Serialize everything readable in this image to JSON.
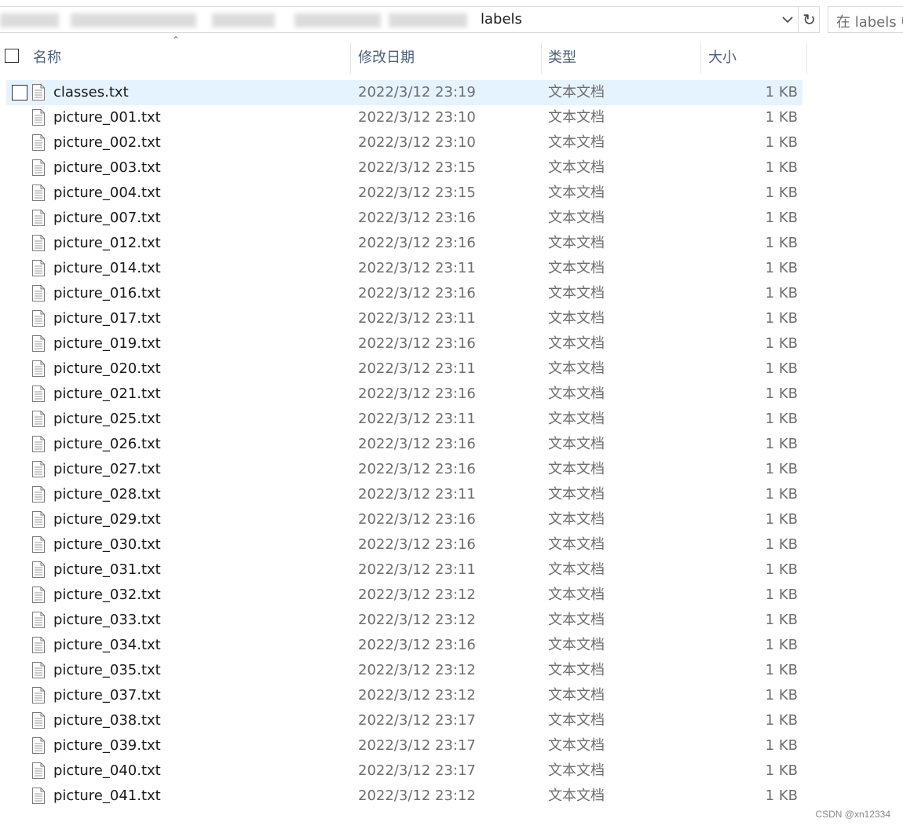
{
  "address_bar": {
    "current_folder": "labels",
    "search_placeholder": "在 labels 中搜索"
  },
  "columns": {
    "name": "名称",
    "date_modified": "修改日期",
    "type": "类型",
    "size": "大小"
  },
  "files": [
    {
      "name": "classes.txt",
      "date": "2022/3/12 23:19",
      "type": "文本文档",
      "size": "1 KB",
      "selected": true
    },
    {
      "name": "picture_001.txt",
      "date": "2022/3/12 23:10",
      "type": "文本文档",
      "size": "1 KB"
    },
    {
      "name": "picture_002.txt",
      "date": "2022/3/12 23:10",
      "type": "文本文档",
      "size": "1 KB"
    },
    {
      "name": "picture_003.txt",
      "date": "2022/3/12 23:15",
      "type": "文本文档",
      "size": "1 KB"
    },
    {
      "name": "picture_004.txt",
      "date": "2022/3/12 23:15",
      "type": "文本文档",
      "size": "1 KB"
    },
    {
      "name": "picture_007.txt",
      "date": "2022/3/12 23:16",
      "type": "文本文档",
      "size": "1 KB"
    },
    {
      "name": "picture_012.txt",
      "date": "2022/3/12 23:16",
      "type": "文本文档",
      "size": "1 KB"
    },
    {
      "name": "picture_014.txt",
      "date": "2022/3/12 23:11",
      "type": "文本文档",
      "size": "1 KB"
    },
    {
      "name": "picture_016.txt",
      "date": "2022/3/12 23:16",
      "type": "文本文档",
      "size": "1 KB"
    },
    {
      "name": "picture_017.txt",
      "date": "2022/3/12 23:11",
      "type": "文本文档",
      "size": "1 KB"
    },
    {
      "name": "picture_019.txt",
      "date": "2022/3/12 23:16",
      "type": "文本文档",
      "size": "1 KB"
    },
    {
      "name": "picture_020.txt",
      "date": "2022/3/12 23:11",
      "type": "文本文档",
      "size": "1 KB"
    },
    {
      "name": "picture_021.txt",
      "date": "2022/3/12 23:16",
      "type": "文本文档",
      "size": "1 KB"
    },
    {
      "name": "picture_025.txt",
      "date": "2022/3/12 23:11",
      "type": "文本文档",
      "size": "1 KB"
    },
    {
      "name": "picture_026.txt",
      "date": "2022/3/12 23:16",
      "type": "文本文档",
      "size": "1 KB"
    },
    {
      "name": "picture_027.txt",
      "date": "2022/3/12 23:16",
      "type": "文本文档",
      "size": "1 KB"
    },
    {
      "name": "picture_028.txt",
      "date": "2022/3/12 23:11",
      "type": "文本文档",
      "size": "1 KB"
    },
    {
      "name": "picture_029.txt",
      "date": "2022/3/12 23:16",
      "type": "文本文档",
      "size": "1 KB"
    },
    {
      "name": "picture_030.txt",
      "date": "2022/3/12 23:16",
      "type": "文本文档",
      "size": "1 KB"
    },
    {
      "name": "picture_031.txt",
      "date": "2022/3/12 23:11",
      "type": "文本文档",
      "size": "1 KB"
    },
    {
      "name": "picture_032.txt",
      "date": "2022/3/12 23:12",
      "type": "文本文档",
      "size": "1 KB"
    },
    {
      "name": "picture_033.txt",
      "date": "2022/3/12 23:12",
      "type": "文本文档",
      "size": "1 KB"
    },
    {
      "name": "picture_034.txt",
      "date": "2022/3/12 23:16",
      "type": "文本文档",
      "size": "1 KB"
    },
    {
      "name": "picture_035.txt",
      "date": "2022/3/12 23:12",
      "type": "文本文档",
      "size": "1 KB"
    },
    {
      "name": "picture_037.txt",
      "date": "2022/3/12 23:12",
      "type": "文本文档",
      "size": "1 KB"
    },
    {
      "name": "picture_038.txt",
      "date": "2022/3/12 23:17",
      "type": "文本文档",
      "size": "1 KB"
    },
    {
      "name": "picture_039.txt",
      "date": "2022/3/12 23:17",
      "type": "文本文档",
      "size": "1 KB"
    },
    {
      "name": "picture_040.txt",
      "date": "2022/3/12 23:17",
      "type": "文本文档",
      "size": "1 KB"
    },
    {
      "name": "picture_041.txt",
      "date": "2022/3/12 23:12",
      "type": "文本文档",
      "size": "1 KB"
    }
  ],
  "watermark": "CSDN @xn12334",
  "colors": {
    "selection": "#e5f3ff",
    "header_text": "#4c607a",
    "secondary_text": "#6d6d6d"
  }
}
